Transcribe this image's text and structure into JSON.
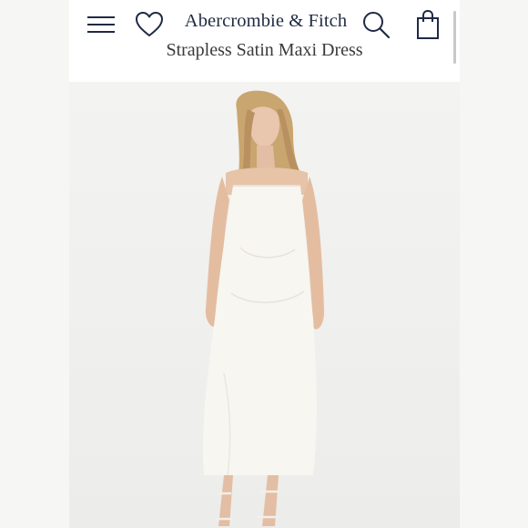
{
  "header": {
    "brand": "Abercrombie & Fitch",
    "product_title": "Strapless Satin Maxi Dress"
  },
  "icons": {
    "menu": "hamburger-menu-icon",
    "wishlist": "heart-icon",
    "search": "search-icon",
    "bag": "shopping-bag-icon"
  },
  "colors": {
    "brand_navy": "#1f2a44",
    "page_background": "#f4f4f3",
    "dress": "#f7f6f1"
  }
}
